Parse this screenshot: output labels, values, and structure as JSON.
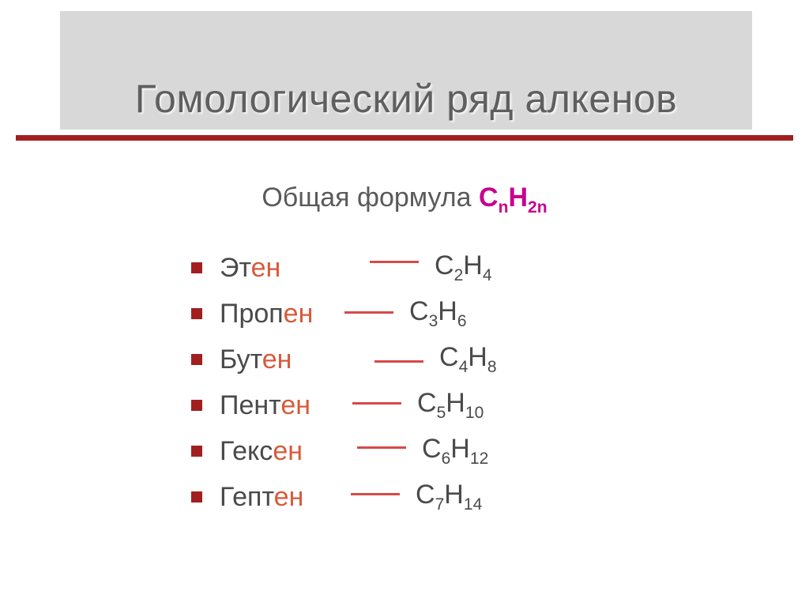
{
  "title": "Гомологический ряд алкенов",
  "subtitle": {
    "label": "Общая формула",
    "formula_c": "С",
    "formula_sub_n": "n",
    "formula_h": "H",
    "formula_sub_2n": "2n"
  },
  "items": [
    {
      "root": "Эт",
      "suffix": "ен",
      "c": "C",
      "c_sub": "2",
      "h": "H",
      "h_sub": "4"
    },
    {
      "root": "Проп",
      "suffix": "ен",
      "c": "C",
      "c_sub": "3",
      "h": "H",
      "h_sub": "6"
    },
    {
      "root": "Бут",
      "suffix": "ен",
      "c": "C",
      "c_sub": "4",
      "h": "H",
      "h_sub": "8"
    },
    {
      "root": "Пент",
      "suffix": "ен",
      "c": "C",
      "c_sub": "5",
      "h": "H",
      "h_sub": "10"
    },
    {
      "root": "Гекс",
      "suffix": "ен",
      "c": "C",
      "c_sub": "6",
      "h": "H",
      "h_sub": "12"
    },
    {
      "root": "Гепт",
      "suffix": "ен",
      "c": "C",
      "c_sub": "7",
      "h": "H",
      "h_sub": "14"
    }
  ]
}
